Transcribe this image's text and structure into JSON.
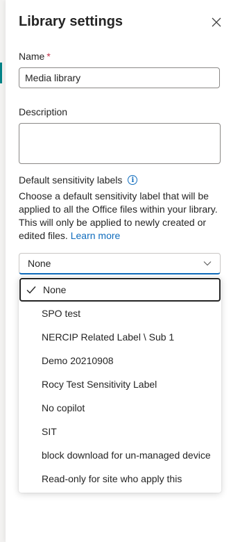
{
  "panel": {
    "title": "Library settings",
    "name_label": "Name",
    "required_marker": "*",
    "name_value": "Media library",
    "description_label": "Description",
    "description_value": "",
    "sensitivity_label": "Default sensitivity labels",
    "sensitivity_description": "Choose a default sensitivity label that will be applied to all the Office files within your library. This will only be applied to newly created or edited files.",
    "learn_more": "Learn more",
    "select_value": "None",
    "options": [
      {
        "label": "None",
        "selected": true
      },
      {
        "label": "SPO test",
        "selected": false
      },
      {
        "label": "NERCIP Related Label \\ Sub 1",
        "selected": false
      },
      {
        "label": "Demo 20210908",
        "selected": false
      },
      {
        "label": "Rocy Test Sensitivity Label",
        "selected": false
      },
      {
        "label": "No copilot",
        "selected": false
      },
      {
        "label": "SIT",
        "selected": false
      },
      {
        "label": "block download for un-managed device",
        "selected": false
      },
      {
        "label": "Read-only for site who apply this",
        "selected": false
      }
    ]
  },
  "icons": {
    "close": "close-icon",
    "info": "info-icon",
    "chevron": "chevron-down-icon",
    "check": "checkmark-icon"
  },
  "colors": {
    "accent": "#0f6cbd",
    "required": "#c4314b",
    "teal": "#038387"
  }
}
